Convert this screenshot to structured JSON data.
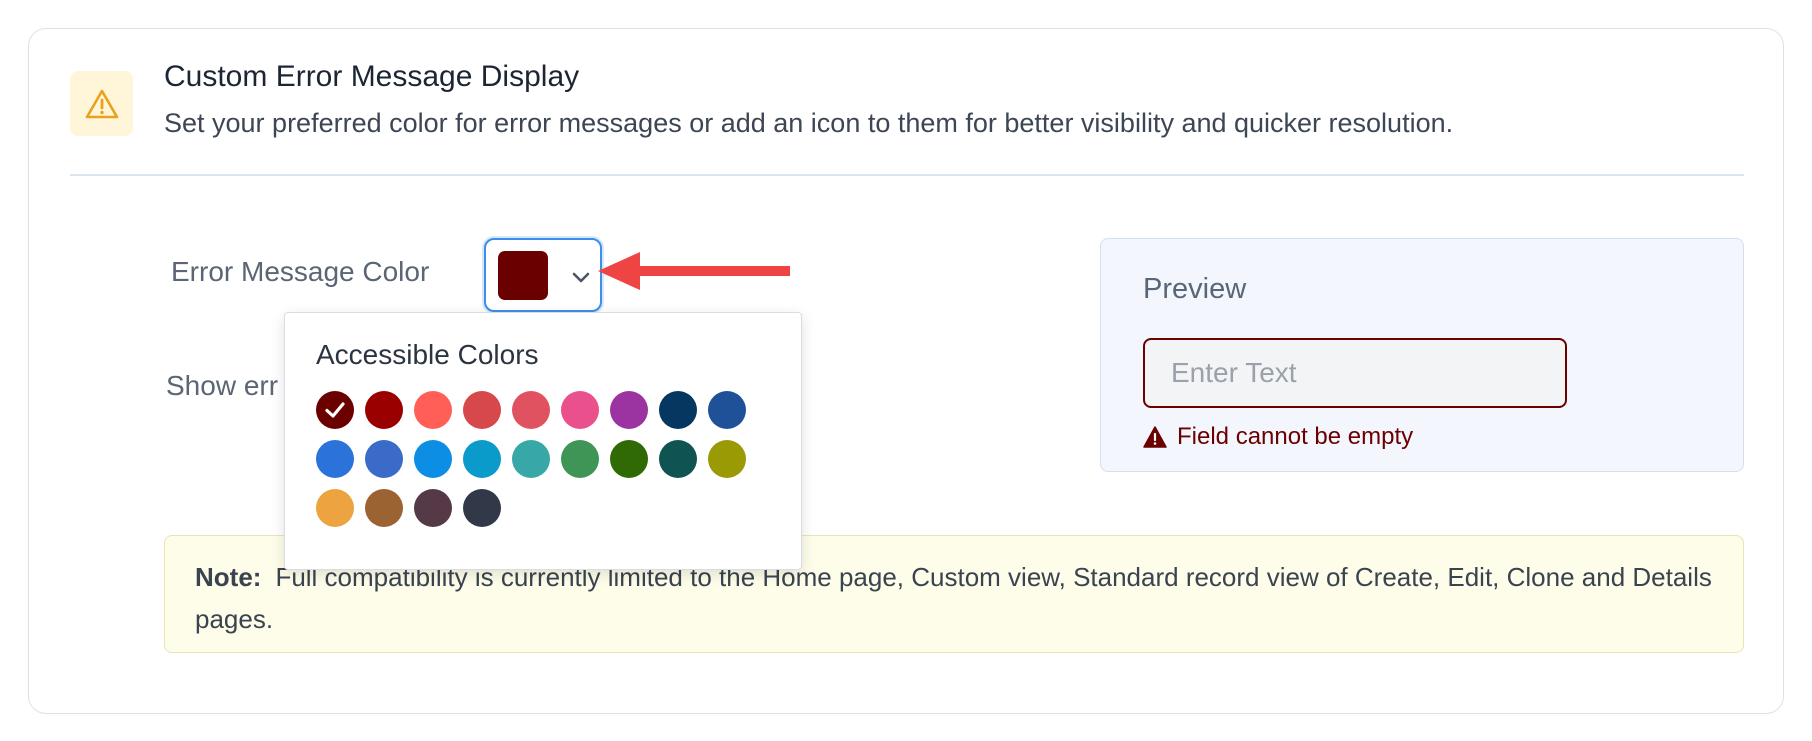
{
  "header": {
    "title": "Custom Error Message Display",
    "subtitle": "Set your preferred color for error messages or add an icon to them for better visibility and quicker resolution.",
    "icon": "warning-triangle-icon",
    "icon_color": "#e8a21b"
  },
  "form": {
    "color_label": "Error Message Color",
    "show_icon_label": "Show err",
    "selected_color": "#6b0000"
  },
  "dropdown": {
    "title": "Accessible Colors",
    "colors": [
      "#6b0000",
      "#9b0000",
      "#ff5f57",
      "#d6484a",
      "#e15260",
      "#e9508c",
      "#9b34a0",
      "#053761",
      "#1f5199",
      "#2c72db",
      "#3a6bc9",
      "#0b8ee4",
      "#0b9bcb",
      "#38a7a7",
      "#3f9556",
      "#2f6a05",
      "#0f5353",
      "#9a9a04",
      "#eca340",
      "#9a6331",
      "#553946",
      "#313847"
    ],
    "selected_index": 0
  },
  "preview": {
    "title": "Preview",
    "placeholder": "Enter Text",
    "error_text": "Field cannot be empty",
    "error_color": "#6b0000"
  },
  "note": {
    "label": "Note:",
    "text": "Full compatibility is currently limited to the Home page, Custom view, Standard record view of Create, Edit, Clone and Details pages."
  }
}
